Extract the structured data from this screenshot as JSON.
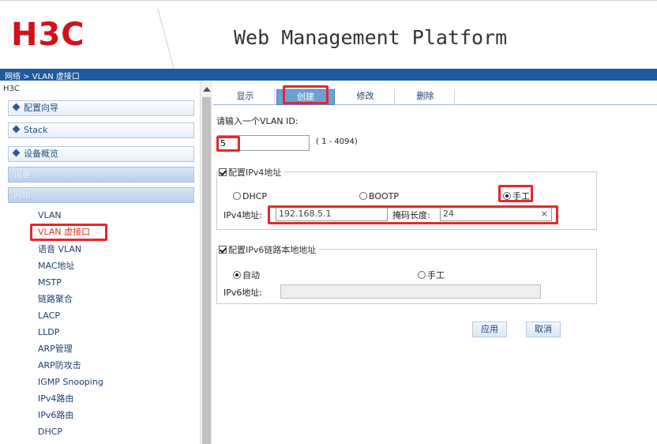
{
  "header": {
    "logo": "H3C",
    "title": "Web Management Platform"
  },
  "breadcrumb": "网络 > VLAN 虚接口",
  "sidebar": {
    "header": "H3C",
    "groups": [
      "配置向导",
      "Stack",
      "设备概览"
    ],
    "sections": [
      "设备",
      "网络"
    ],
    "items": [
      "VLAN",
      "VLAN 虚接口",
      "语音 VLAN",
      "MAC地址",
      "MSTP",
      "链路聚合",
      "LACP",
      "LLDP",
      "ARP管理",
      "ARP防攻击",
      "IGMP Snooping",
      "IPv4路由",
      "IPv6路由",
      "DHCP"
    ]
  },
  "tabs": [
    "显示",
    "创建",
    "修改",
    "删除"
  ],
  "active_tab": "创建",
  "form": {
    "prompt": "请输入一个VLAN ID:",
    "vlan_id": "5",
    "vlan_range": "( 1 - 4094)",
    "ipv4": {
      "legend": "配置IPv4地址",
      "options": [
        "DHCP",
        "BOOTP",
        "手工"
      ],
      "selected": "手工",
      "address_label": "IPv4地址:",
      "address_value": "192.168.5.1",
      "mask_label": "掩码长度:",
      "mask_value": "24",
      "clear_icon": "×"
    },
    "ipv6": {
      "legend": "配置IPv6链路本地地址",
      "options": [
        "自动",
        "手工"
      ],
      "selected": "自动",
      "address_label": "IPv6地址:",
      "address_value": ""
    },
    "buttons": {
      "apply": "应用",
      "cancel": "取消"
    }
  }
}
